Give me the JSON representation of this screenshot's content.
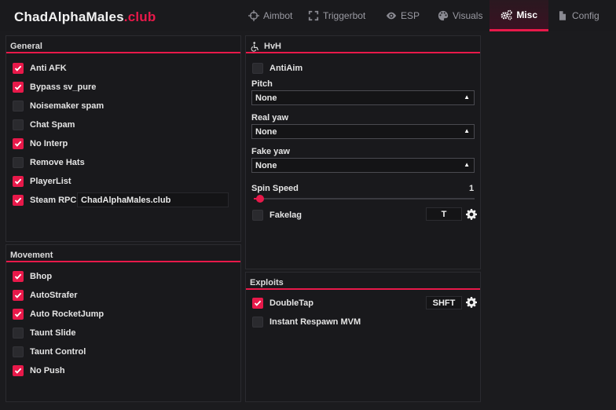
{
  "app": {
    "brand_main": "ChadAlphaMales",
    "brand_accent": ".club"
  },
  "tabs": [
    {
      "label": "Aimbot",
      "icon": "crosshair-icon"
    },
    {
      "label": "Triggerbot",
      "icon": "frame-icon"
    },
    {
      "label": "ESP",
      "icon": "eye-icon"
    },
    {
      "label": "Visuals",
      "icon": "palette-icon"
    },
    {
      "label": "Misc",
      "icon": "gears-icon",
      "active": true
    },
    {
      "label": "Config",
      "icon": "file-icon"
    }
  ],
  "general": {
    "title": "General",
    "items": [
      {
        "label": "Anti AFK",
        "checked": true
      },
      {
        "label": "Bypass sv_pure",
        "checked": true
      },
      {
        "label": "Noisemaker spam",
        "checked": false
      },
      {
        "label": "Chat Spam",
        "checked": false
      },
      {
        "label": "No Interp",
        "checked": true
      },
      {
        "label": "Remove Hats",
        "checked": false
      },
      {
        "label": "PlayerList",
        "checked": true
      },
      {
        "label": "Steam RPC",
        "checked": true
      }
    ],
    "steam_rpc_value": "ChadAlphaMales.club"
  },
  "movement": {
    "title": "Movement",
    "items": [
      {
        "label": "Bhop",
        "checked": true
      },
      {
        "label": "AutoStrafer",
        "checked": true
      },
      {
        "label": "Auto RocketJump",
        "checked": true
      },
      {
        "label": "Taunt Slide",
        "checked": false
      },
      {
        "label": "Taunt Control",
        "checked": false
      },
      {
        "label": "No Push",
        "checked": true
      }
    ]
  },
  "hvh": {
    "title": "HvH",
    "antiaim_label": "AntiAim",
    "antiaim_checked": false,
    "pitch_label": "Pitch",
    "pitch_value": "None",
    "real_yaw_label": "Real yaw",
    "real_yaw_value": "None",
    "fake_yaw_label": "Fake yaw",
    "fake_yaw_value": "None",
    "spin_speed_label": "Spin Speed",
    "spin_speed_value": "1",
    "spin_speed_fraction": 0.03,
    "fakelag_label": "Fakelag",
    "fakelag_checked": false,
    "fakelag_key": "T"
  },
  "exploits": {
    "title": "Exploits",
    "doubletap_label": "DoubleTap",
    "doubletap_checked": true,
    "doubletap_key": "SHFT",
    "respawn_label": "Instant Respawn MVM",
    "respawn_checked": false
  },
  "colors": {
    "accent": "#e8194a",
    "background": "#1b1b1e",
    "panel": "#19191c"
  }
}
